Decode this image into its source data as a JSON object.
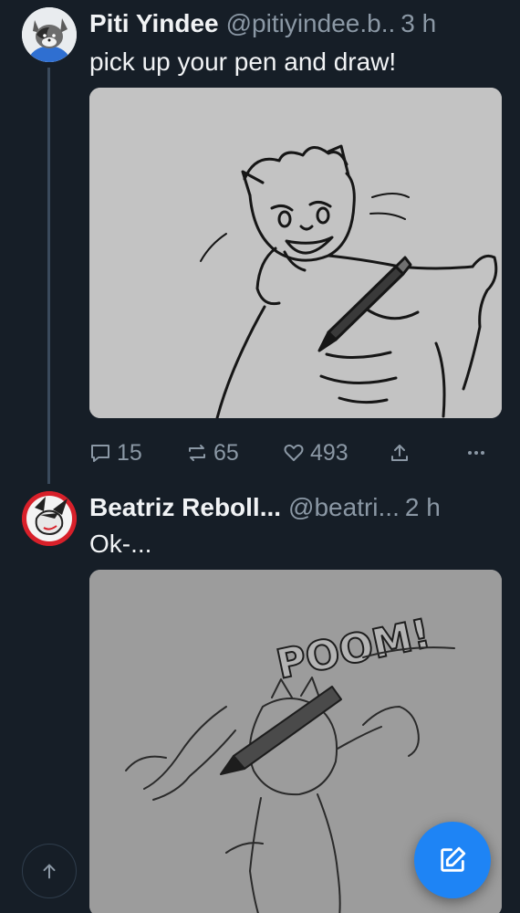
{
  "posts": [
    {
      "author_name": "Piti Yindee",
      "handle": "@pitiyindee.b..",
      "time": "3 h",
      "text": "pick up your pen and draw!",
      "stats": {
        "replies": "15",
        "reposts": "65",
        "likes": "493"
      }
    },
    {
      "author_name": "Beatriz Reboll...",
      "handle": "@beatri...",
      "time": "2 h",
      "text": "Ok-...",
      "image_lettering": "POOM!"
    }
  ],
  "icons": {
    "reply": "speech-bubble-icon",
    "repost": "repost-icon",
    "like": "heart-icon",
    "share": "share-icon",
    "more": "more-dots-icon",
    "scroll_top": "arrow-up-icon",
    "compose": "compose-icon"
  },
  "colors": {
    "background": "#161e27",
    "muted_text": "#8b98a5",
    "accent": "#1e84f5"
  }
}
